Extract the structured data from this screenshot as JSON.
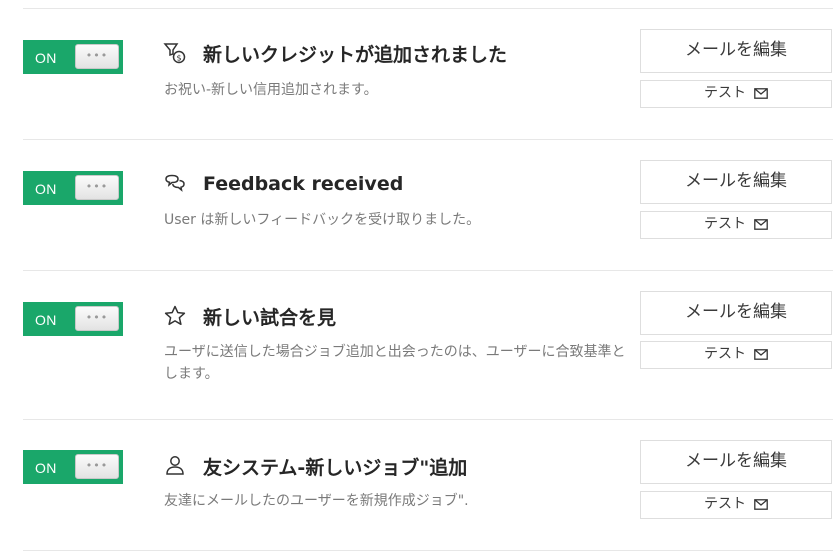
{
  "notifications": [
    {
      "toggle_label": "ON",
      "knob_glyph": "•••",
      "icon": "tag-money-icon",
      "title": "新しいクレジットが追加されました",
      "description": "お祝い-新しい信用追加されます。",
      "edit_label": "メールを編集",
      "test_label": "テスト"
    },
    {
      "toggle_label": "ON",
      "knob_glyph": "•••",
      "icon": "chat-bubbles-icon",
      "title": "Feedback received",
      "description": "User は新しいフィードバックを受け取りました。",
      "edit_label": "メールを編集",
      "test_label": "テスト"
    },
    {
      "toggle_label": "ON",
      "knob_glyph": "•••",
      "icon": "star-icon",
      "title": "新しい試合を見",
      "description": "ユーザに送信した場合ジョブ追加と出会ったのは、ユーザーに合致基準とします。",
      "edit_label": "メールを編集",
      "test_label": "テスト"
    },
    {
      "toggle_label": "ON",
      "knob_glyph": "•••",
      "icon": "user-icon",
      "title": "友システム-新しいジョブ\"追加",
      "description": "友達にメールしたのユーザーを新規作成ジョブ\".",
      "edit_label": "メールを編集",
      "test_label": "テスト"
    }
  ],
  "colors": {
    "toggle_on": "#1aa76a",
    "divider": "#e7e7e7",
    "description": "#7a7a7a"
  }
}
